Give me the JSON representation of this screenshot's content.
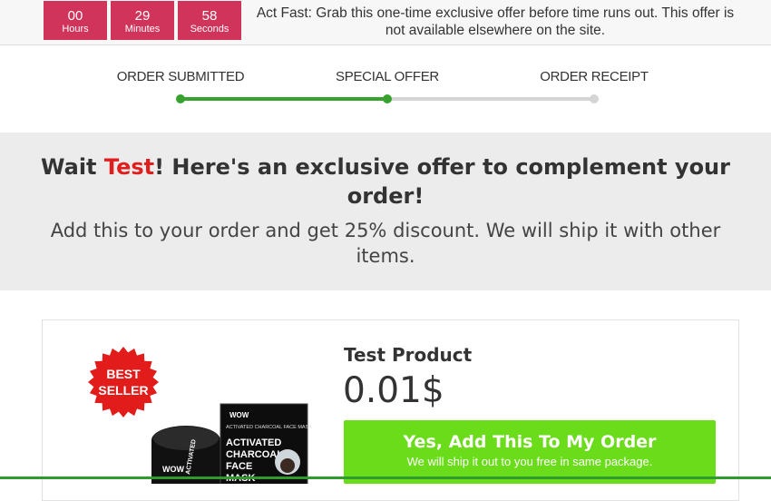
{
  "timer": {
    "hours": {
      "value": "00",
      "label": "Hours"
    },
    "minutes": {
      "value": "29",
      "label": "Minutes"
    },
    "seconds": {
      "value": "58",
      "label": "Seconds"
    },
    "message": "Act Fast: Grab this one-time exclusive offer before time runs out. This offer is not available elsewhere on the site."
  },
  "progress": {
    "steps": [
      "ORDER SUBMITTED",
      "SPECIAL OFFER",
      "ORDER RECEIPT"
    ],
    "current_step": 2,
    "fill_fraction": 0.5,
    "colors": {
      "active": "#37a32e",
      "inactive": "#d5d5d5"
    }
  },
  "headline": {
    "prefix": "Wait ",
    "name": "Test",
    "suffix": "! Here's an exclusive offer to complement your order!",
    "subtext": "Add this to your order and get 25% discount. We will ship it with other items."
  },
  "product": {
    "badge_line1": "BEST",
    "badge_line2": "SELLER",
    "title": "Test Product",
    "price": "0.01$",
    "image_text": {
      "brand": "WOW",
      "subtitle": "ACTIVATED CHARCOAL FACE MASK",
      "big1": "ACTIVATED",
      "big2": "CHARCOAL",
      "big3": "FACE",
      "big4": "MASK"
    },
    "cta_label": "Yes, Add This To My Order",
    "cta_sub": "We will ship it out to you free in same package."
  },
  "colors": {
    "timer_box": "#d0345a",
    "name_highlight": "#e11e1e",
    "cta": "#6bdc1a",
    "badge": "#e21b1b"
  }
}
